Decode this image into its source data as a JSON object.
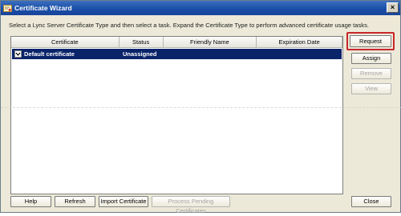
{
  "window": {
    "title": "Certificate Wizard",
    "close_glyph": "×"
  },
  "instruction": "Select a Lync Server Certificate Type and then select a task. Expand the Certificate Type to perform advanced certificate usage tasks.",
  "table": {
    "columns": [
      "Certificate",
      "Status",
      "Friendly Name",
      "Expiration Date"
    ],
    "rows": [
      {
        "certificate": "Default certificate",
        "status": "Unassigned",
        "friendly_name": "",
        "expiration_date": ""
      }
    ]
  },
  "side_buttons": {
    "request": "Request",
    "assign": "Assign",
    "remove": "Remove",
    "view": "View"
  },
  "bottom_buttons": {
    "help": "Help",
    "refresh": "Refresh",
    "import_certificate": "Import Certificate",
    "process_pending": "Process Pending Certificates",
    "close": "Close"
  },
  "colors": {
    "title_bar": "#1a4fa8",
    "selection": "#0a246a",
    "highlight_box": "#c8262b"
  },
  "icons": {
    "title": "certificate-icon",
    "expander": "chevron-down-icon"
  }
}
